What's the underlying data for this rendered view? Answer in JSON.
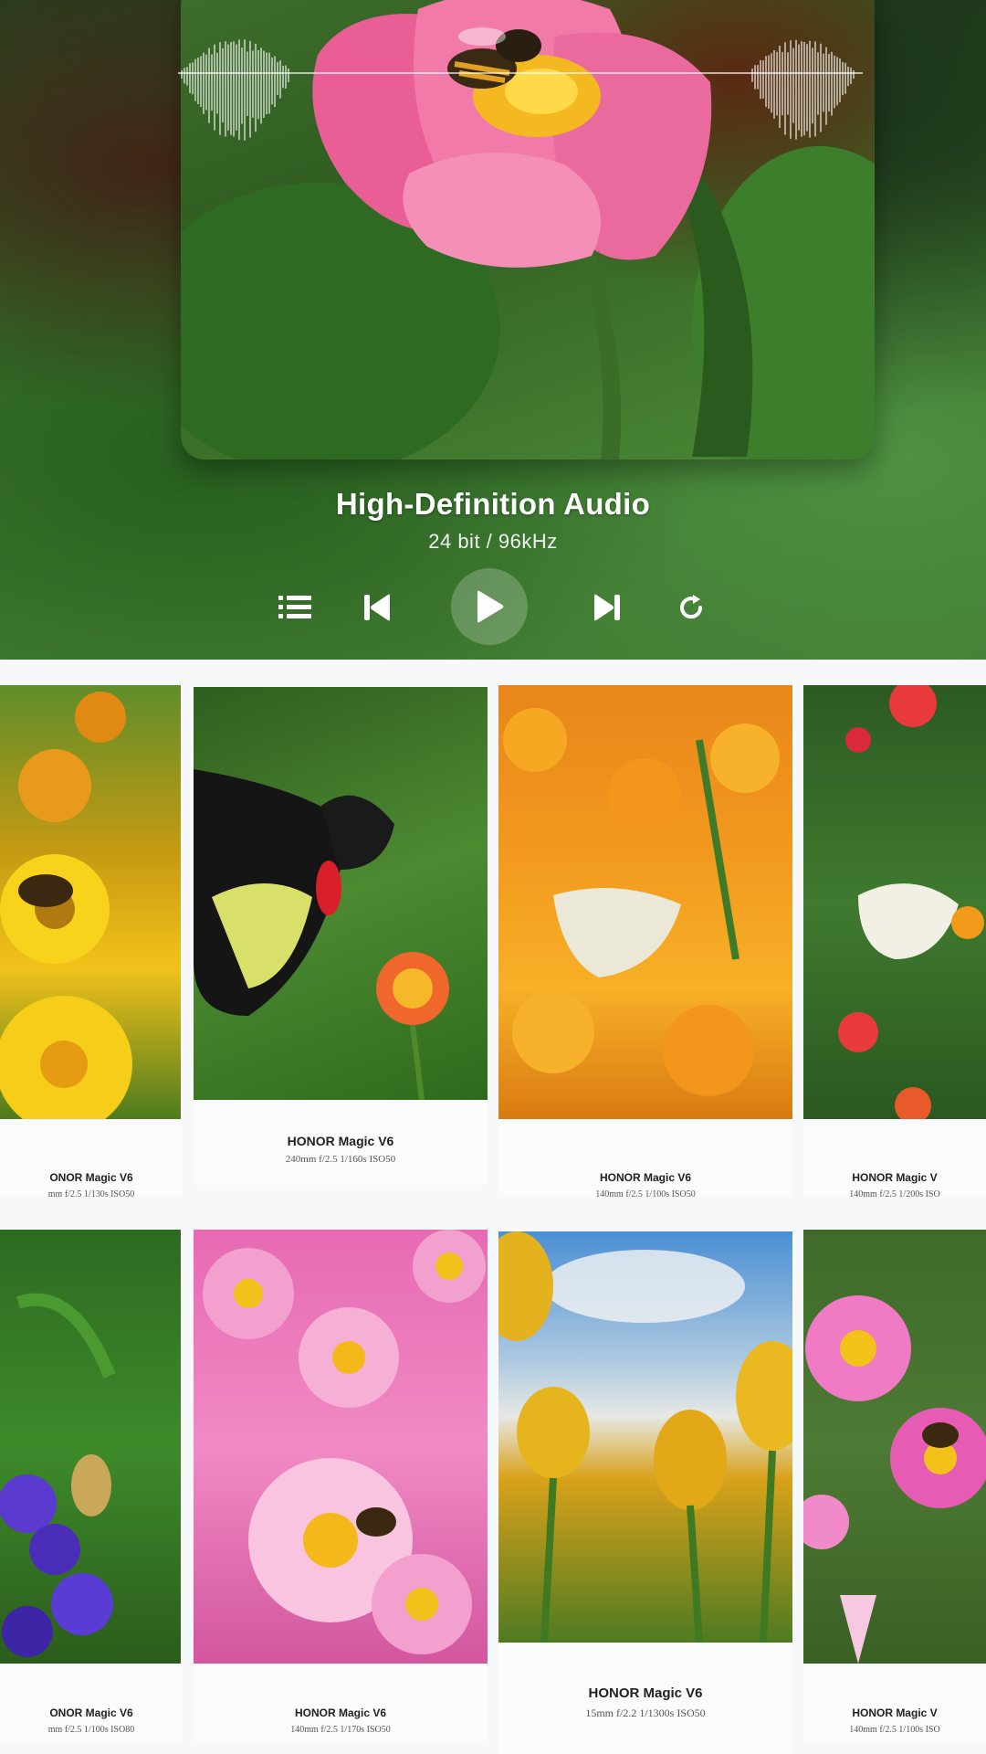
{
  "player": {
    "title": "High-Definition Audio",
    "subtitle": "24 bit / 96kHz",
    "controls": {
      "playlist_icon": "playlist-icon",
      "previous_icon": "skip-previous-icon",
      "play_icon": "play-icon",
      "next_icon": "skip-next-icon",
      "repeat_icon": "repeat-icon"
    }
  },
  "gallery": {
    "row1": [
      {
        "title": "ONOR Magic V6",
        "meta": "mm  f/2.5  1/130s  ISO50"
      },
      {
        "title": "HONOR Magic V6",
        "meta": "240mm  f/2.5  1/160s  ISO50"
      },
      {
        "title": "HONOR Magic V6",
        "meta": "140mm  f/2.5  1/100s  ISO50"
      },
      {
        "title": "HONOR Magic V",
        "meta": "140mm  f/2.5  1/200s  ISO"
      }
    ],
    "row2": [
      {
        "title": "ONOR Magic V6",
        "meta": "mm  f/2.5  1/100s  ISO80"
      },
      {
        "title": "HONOR Magic V6",
        "meta": "140mm  f/2.5  1/170s  ISO50"
      },
      {
        "title": "HONOR Magic V6",
        "meta": "15mm  f/2.2  1/1300s  ISO50"
      },
      {
        "title": "HONOR Magic V",
        "meta": "140mm  f/2.5  1/100s  ISO"
      }
    ]
  }
}
